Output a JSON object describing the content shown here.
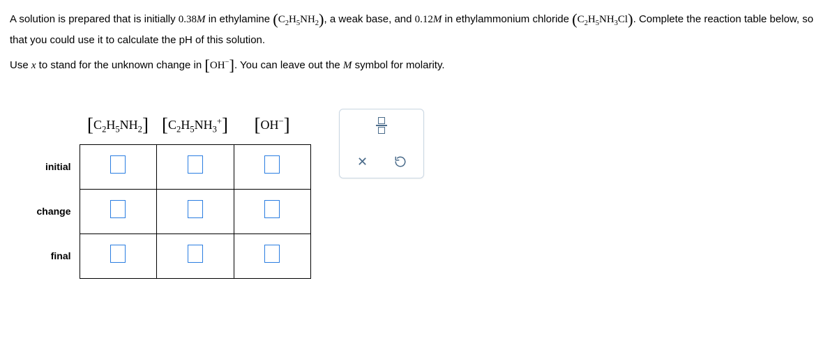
{
  "problem": {
    "text_a": "A solution is prepared that is initially ",
    "conc1": "0.38",
    "unit1": "M",
    "text_b": " in ethylamine ",
    "formula1_html": "C<sub>2</sub>H<sub>5</sub>NH<sub>2</sub>",
    "text_c": ", a weak base, and ",
    "conc2": "0.12",
    "unit2": "M",
    "text_d": " in ethylammonium chloride ",
    "formula2_html": "C<sub>2</sub>H<sub>5</sub>NH<sub>3</sub>Cl",
    "text_e": ". Complete the reaction table below, so that you could use it to calculate the pH of this solution.",
    "line2_a": "Use ",
    "line2_x": "x",
    "line2_b": " to stand for the unknown change in ",
    "line2_oh_html": "OH<sup>−</sup>",
    "line2_c": ". You can leave out the ",
    "line2_M": "M",
    "line2_d": " symbol for molarity."
  },
  "table": {
    "headers": {
      "col1_html": "C<sub>2</sub>H<sub>5</sub>NH<sub>2</sub>",
      "col2_html": "C<sub>2</sub>H<sub>5</sub>NH<sub>3</sub><sup>+</sup>",
      "col3_html": "OH<sup>−</sup>"
    },
    "rows": {
      "initial": "initial",
      "change": "change",
      "final": "final"
    }
  },
  "toolbar": {
    "fraction_tool": "fraction",
    "clear": "clear",
    "reset": "reset"
  }
}
